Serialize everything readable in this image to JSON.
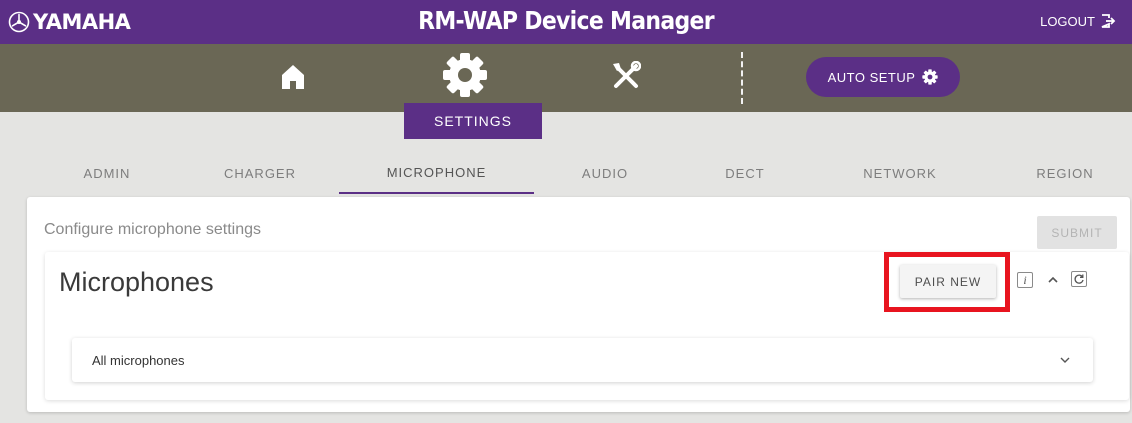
{
  "header": {
    "brand": "YAMAHA",
    "title": "RM-WAP Device Manager",
    "logout_label": "LOGOUT"
  },
  "nav": {
    "icons": [
      "home-icon",
      "gear-icon",
      "tools-icon"
    ],
    "auto_setup_label": "AUTO SETUP",
    "active_section": "SETTINGS"
  },
  "tabs": [
    {
      "label": "ADMIN"
    },
    {
      "label": "CHARGER"
    },
    {
      "label": "MICROPHONE",
      "active": true
    },
    {
      "label": "AUDIO"
    },
    {
      "label": "DECT"
    },
    {
      "label": "NETWORK"
    },
    {
      "label": "REGION"
    }
  ],
  "main": {
    "description": "Configure microphone settings",
    "submit_label": "SUBMIT",
    "panel": {
      "title": "Microphones",
      "pair_new_label": "PAIR NEW",
      "info_label": "i",
      "accordion_label": "All microphones"
    }
  },
  "colors": {
    "brand_purple": "#5b2f86",
    "nav_olive": "#6a6755",
    "background": "#e4e4e2",
    "highlight_red": "#e8141f"
  }
}
